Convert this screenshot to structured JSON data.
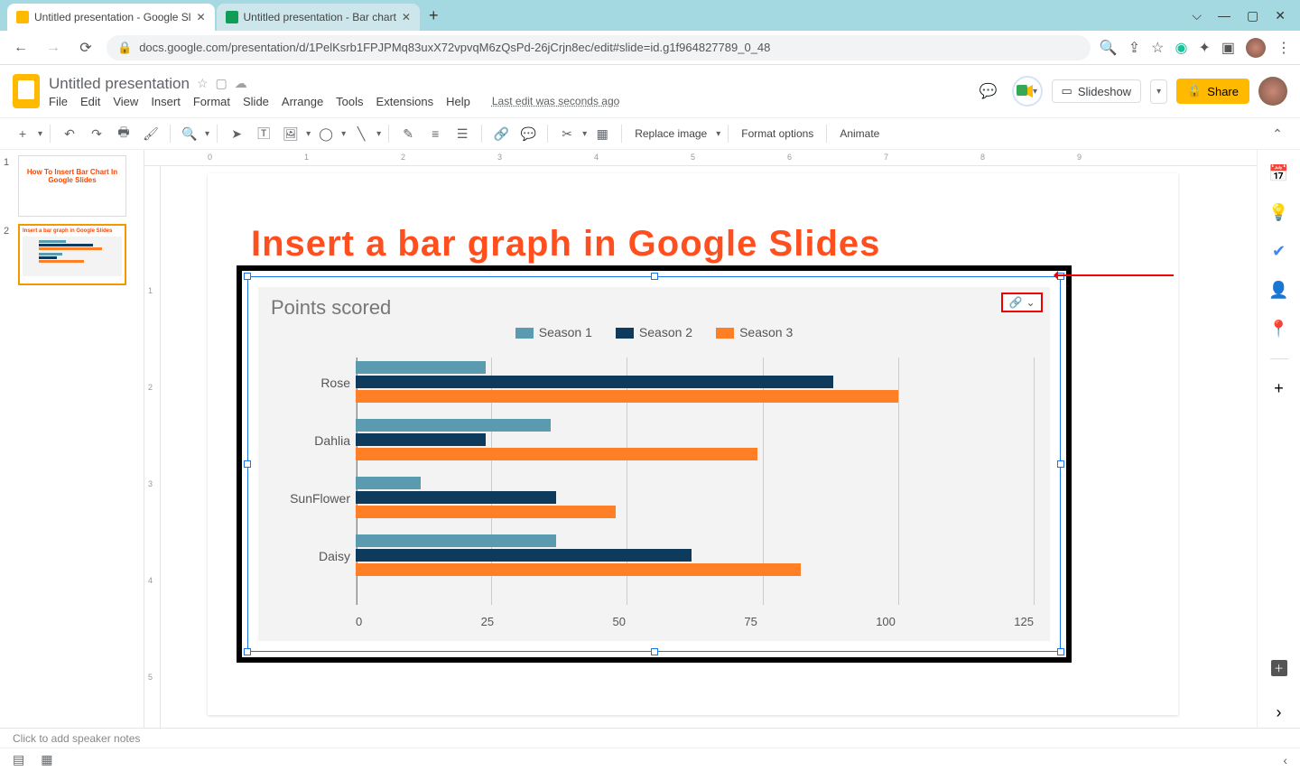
{
  "browser": {
    "tabs": [
      {
        "title": "Untitled presentation - Google Sl",
        "icon_color": "#ffba00"
      },
      {
        "title": "Untitled presentation - Bar chart",
        "icon_color": "#0f9d58"
      }
    ],
    "url_display": "docs.google.com/presentation/d/1PelKsrb1FPJPMq83uxX72vpvqM6zQsPd-26jCrjn8ec/edit#slide=id.g1f964827789_0_48"
  },
  "app": {
    "doc_title": "Untitled presentation",
    "menus": [
      "File",
      "Edit",
      "View",
      "Insert",
      "Format",
      "Slide",
      "Arrange",
      "Tools",
      "Extensions",
      "Help"
    ],
    "edit_info": "Last edit was seconds ago",
    "slideshow_label": "Slideshow",
    "share_label": "Share"
  },
  "toolbar": {
    "replace_image": "Replace image",
    "format_options": "Format options",
    "animate": "Animate"
  },
  "slides_panel": {
    "thumb1_text": "How To Insert Bar Chart In Google Slides",
    "thumb2_text": "Insert a bar graph in Google Slides"
  },
  "slide": {
    "title": "Insert a bar graph in Google Slides"
  },
  "speaker_notes_placeholder": "Click to add speaker notes",
  "chart_data": {
    "type": "bar",
    "orientation": "horizontal",
    "title": "Points scored",
    "categories": [
      "Rose",
      "Dahlia",
      "SunFlower",
      "Daisy"
    ],
    "series": [
      {
        "name": "Season 1",
        "color": "#5b9bb0",
        "values": [
          24,
          36,
          12,
          37
        ]
      },
      {
        "name": "Season 2",
        "color": "#0e3a5c",
        "values": [
          88,
          24,
          37,
          62
        ]
      },
      {
        "name": "Season 3",
        "color": "#ff7f27",
        "values": [
          100,
          74,
          48,
          82
        ]
      }
    ],
    "xlim": [
      0,
      125
    ],
    "xticks": [
      0,
      25,
      50,
      75,
      100,
      125
    ],
    "legend_position": "top"
  },
  "colors": {
    "series1": "#5b9bb0",
    "series2": "#0e3a5c",
    "series3": "#ff7f27",
    "title_orange": "#ff4f1f"
  }
}
